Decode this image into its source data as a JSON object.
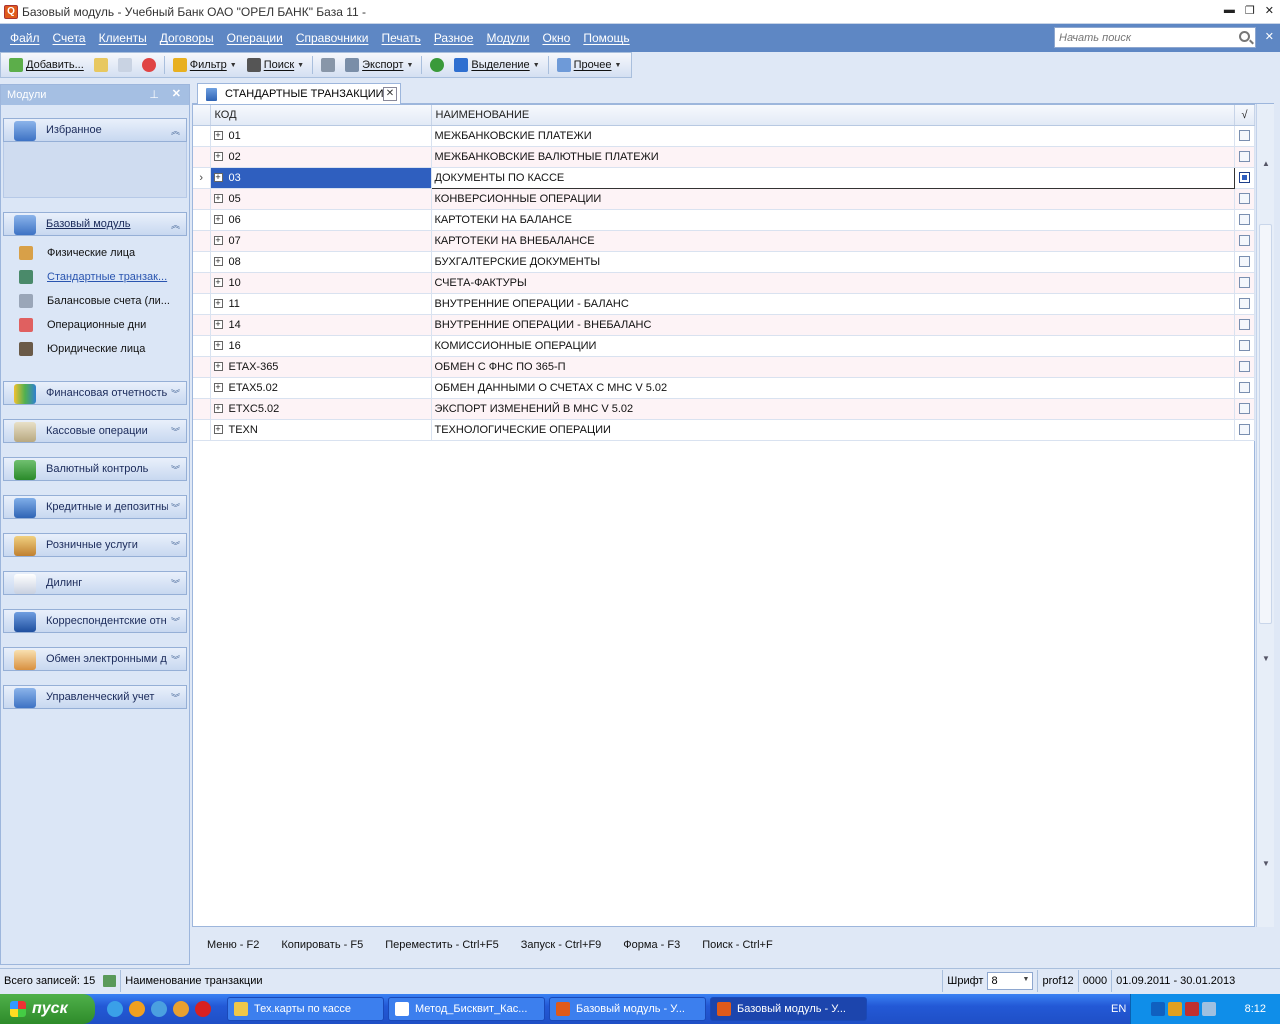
{
  "window": {
    "title": "Базовый модуль - Учебный Банк ОАО \"ОРЕЛ БАНК\" База 11 -"
  },
  "menu": [
    "Файл",
    "Счета",
    "Клиенты",
    "Договоры",
    "Операции",
    "Справочники",
    "Печать",
    "Разное",
    "Модули",
    "Окно",
    "Помощь"
  ],
  "search": {
    "placeholder": "Начать поиск"
  },
  "toolbar": {
    "add": "Добавить...",
    "filter": "Фильтр",
    "find": "Поиск",
    "export": "Экспорт",
    "selection": "Выделение",
    "other": "Прочее"
  },
  "sidebar": {
    "title": "Модули",
    "favorites": "Избранное",
    "base_module": "Базовый модуль",
    "items": [
      "Физические лица",
      "Стандартные транзак...",
      "Балансовые счета (ли...",
      "Операционные дни",
      "Юридические лица"
    ],
    "groups": [
      "Финансовая отчетность",
      "Кассовые операции",
      "Валютный контроль",
      "Кредитные и депозитные",
      "Розничные услуги",
      "Дилинг",
      "Корреспондентские отн",
      "Обмен электронными д",
      "Управленческий учет"
    ]
  },
  "tab": {
    "label": "СТАНДАРТНЫЕ ТРАНЗАКЦИИ"
  },
  "table": {
    "headers": {
      "code": "КОД",
      "name": "НАИМЕНОВАНИЕ",
      "check": "√"
    },
    "rows": [
      {
        "code": "01",
        "name": "МЕЖБАНКОВСКИЕ ПЛАТЕЖИ"
      },
      {
        "code": "02",
        "name": "МЕЖБАНКОВСКИЕ ВАЛЮТНЫЕ ПЛАТЕЖИ"
      },
      {
        "code": "03",
        "name": "ДОКУМЕНТЫ ПО КАССЕ"
      },
      {
        "code": "05",
        "name": "КОНВЕРСИОННЫЕ ОПЕРАЦИИ"
      },
      {
        "code": "06",
        "name": "КАРТОТЕКИ НА БАЛАНСЕ"
      },
      {
        "code": "07",
        "name": "КАРТОТЕКИ НА ВНЕБАЛАНСЕ"
      },
      {
        "code": "08",
        "name": "БУХГАЛТЕРСКИЕ ДОКУМЕНТЫ"
      },
      {
        "code": "10",
        "name": "СЧЕТА-ФАКТУРЫ"
      },
      {
        "code": "11",
        "name": "ВНУТРЕННИЕ ОПЕРАЦИИ - БАЛАНС"
      },
      {
        "code": "14",
        "name": "ВНУТРЕННИЕ ОПЕРАЦИИ - ВНЕБАЛАНС"
      },
      {
        "code": "16",
        "name": "КОМИССИОННЫЕ ОПЕРАЦИИ"
      },
      {
        "code": "ETAX-365",
        "name": "ОБМЕН С ФНС ПО 365-П"
      },
      {
        "code": "ETAX5.02",
        "name": "ОБМЕН ДАННЫМИ О СЧЕТАХ С МНС V 5.02"
      },
      {
        "code": "ETXC5.02",
        "name": "ЭКСПОРТ ИЗМЕНЕНИЙ В МНС V 5.02"
      },
      {
        "code": "TEXN",
        "name": "ТЕХНОЛОГИЧЕСКИЕ ОПЕРАЦИИ"
      }
    ],
    "selected_index": 2
  },
  "hotkeys": [
    "Меню - F2",
    "Копировать - F5",
    "Переместить - Ctrl+F5",
    "Запуск - Ctrl+F9",
    "Форма - F3",
    "Поиск - Ctrl+F"
  ],
  "status": {
    "total": "Всего записей: 15",
    "field": "Наименование транзакции",
    "font_label": "Шрифт",
    "font_value": "8",
    "user": "prof12",
    "branch": "0000",
    "period": "01.09.2011 - 30.01.2013"
  },
  "taskbar": {
    "start": "пуск",
    "tasks": [
      "Тех.карты по кассе",
      "Метод_Бисквит_Кас...",
      "Базовый модуль - У...",
      "Базовый модуль - У..."
    ],
    "lang": "EN",
    "clock": "8:12"
  }
}
